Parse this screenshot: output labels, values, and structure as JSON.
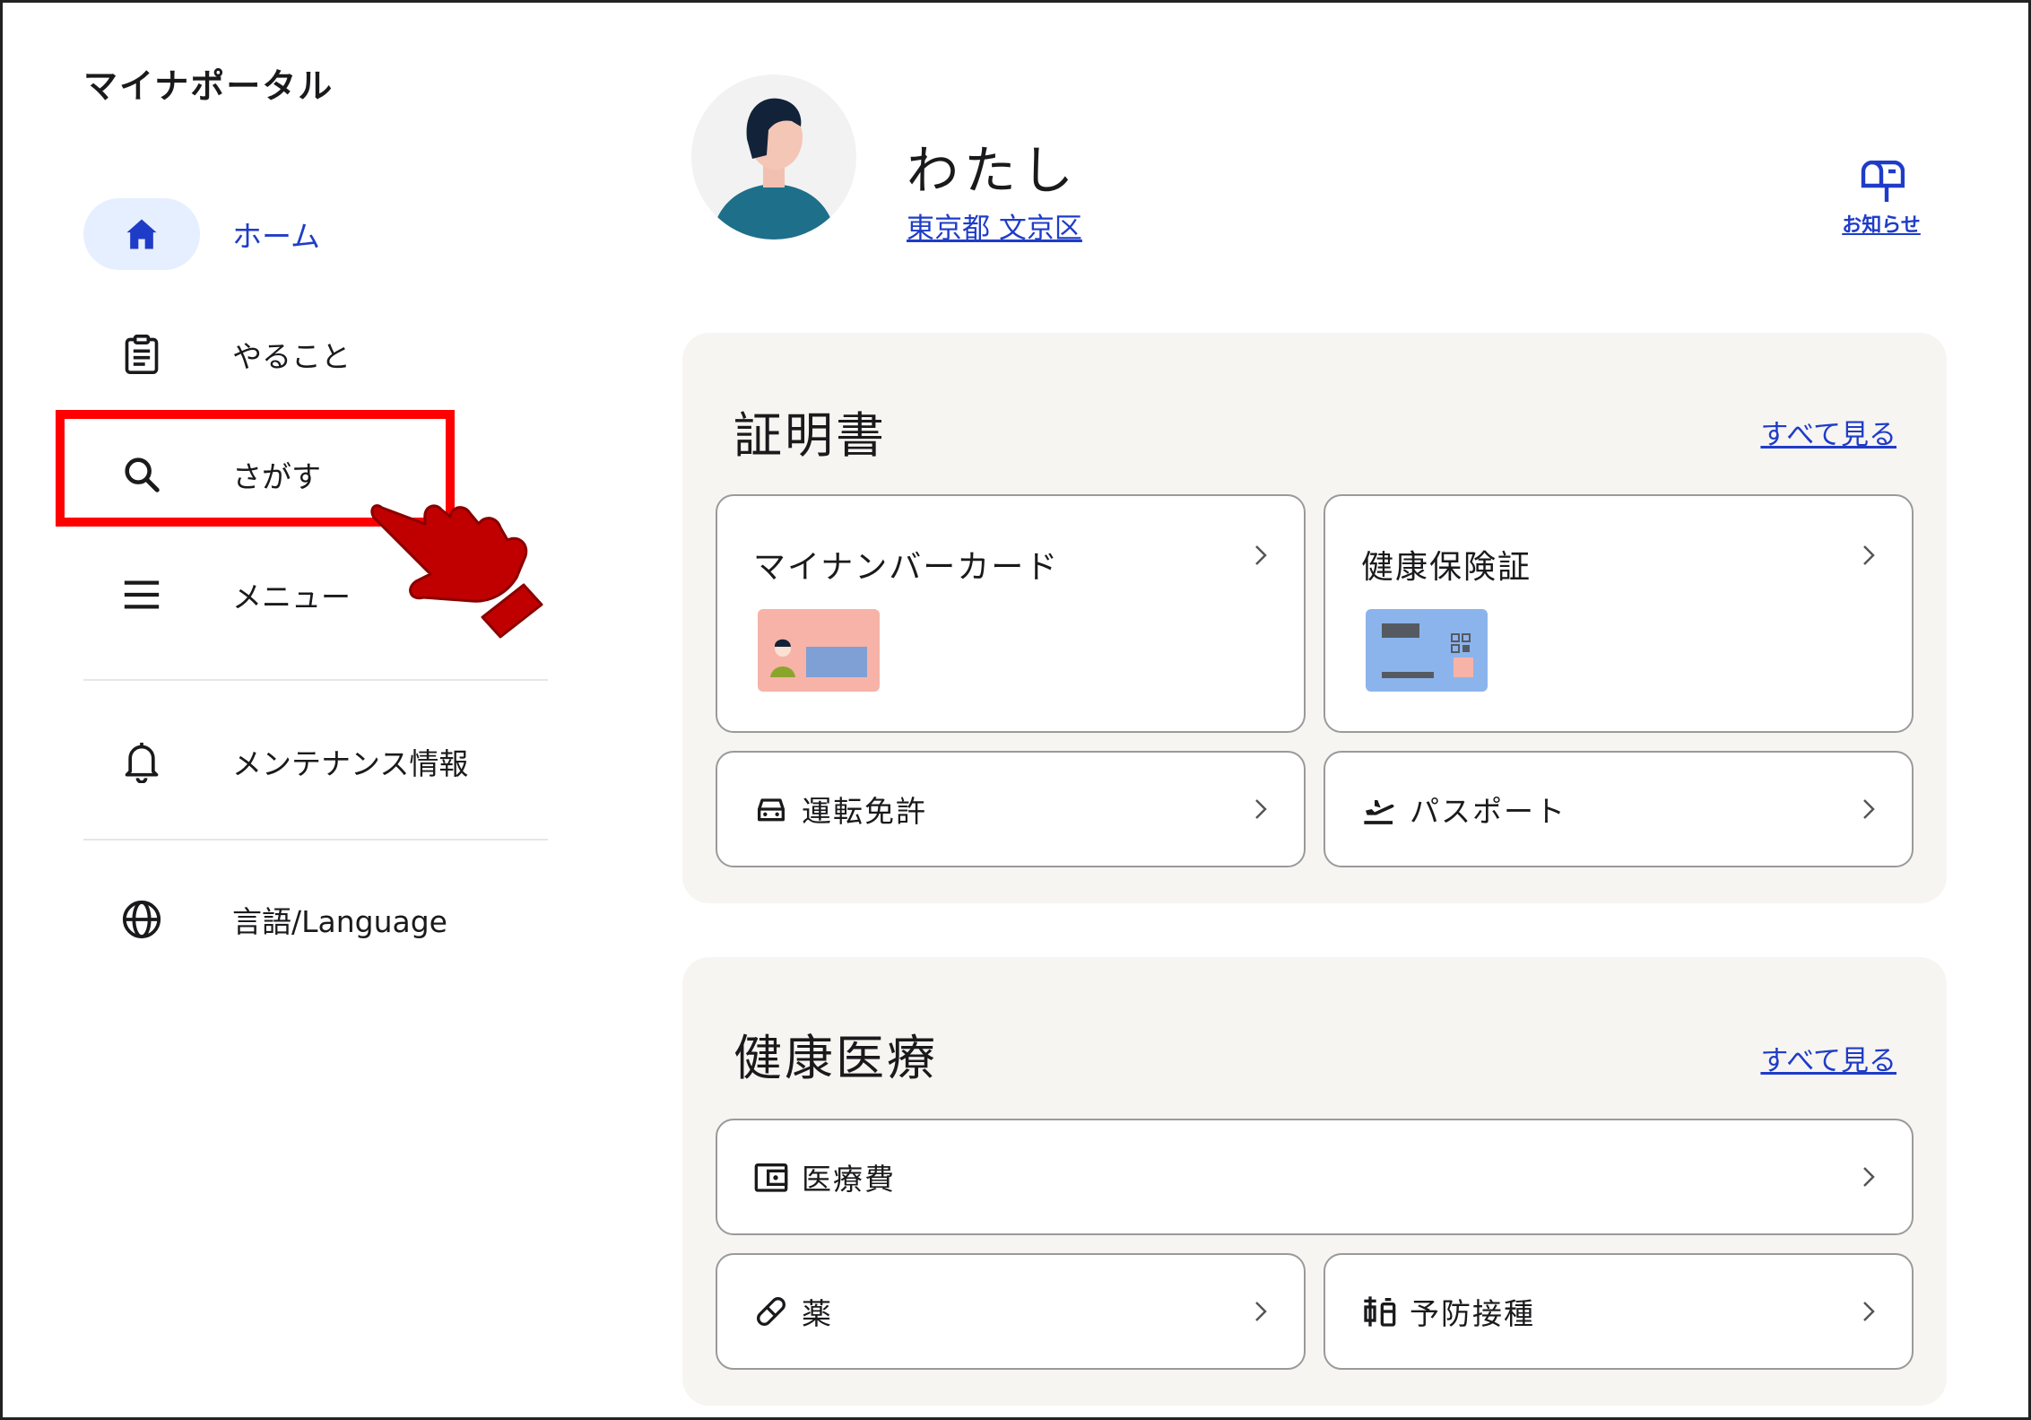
{
  "app": {
    "title": "マイナポータル"
  },
  "sidebar": {
    "items": [
      {
        "label": "ホーム",
        "icon": "home-icon",
        "active": true
      },
      {
        "label": "やること",
        "icon": "clipboard-icon"
      },
      {
        "label": "さがす",
        "icon": "search-icon"
      },
      {
        "label": "メニュー",
        "icon": "menu-icon"
      }
    ],
    "extra": [
      {
        "label": "メンテナンス情報",
        "icon": "bell-icon"
      },
      {
        "label": "言語/Language",
        "icon": "globe-icon"
      }
    ]
  },
  "profile": {
    "name": "わたし",
    "location": "東京都 文京区",
    "notice_label": "お知らせ"
  },
  "certificates": {
    "title": "証明書",
    "see_all": "すべて見る",
    "cards": [
      {
        "label": "マイナンバーカード",
        "icon": "my-number-card-illustration"
      },
      {
        "label": "健康保険証",
        "icon": "insurance-card-illustration"
      },
      {
        "label": "運転免許",
        "icon": "car-icon"
      },
      {
        "label": "パスポート",
        "icon": "airplane-icon"
      }
    ]
  },
  "health": {
    "title": "健康医療",
    "see_all": "すべて見る",
    "cards": [
      {
        "label": "医療費",
        "icon": "wallet-icon"
      },
      {
        "label": "薬",
        "icon": "pill-icon"
      },
      {
        "label": "予防接種",
        "icon": "vaccine-icon"
      }
    ]
  },
  "colors": {
    "accent": "#1f3cc8",
    "active_bg": "#e6efff",
    "panel_bg": "#f7f5f2",
    "highlight": "#ff0000",
    "pointer": "#c00000"
  }
}
